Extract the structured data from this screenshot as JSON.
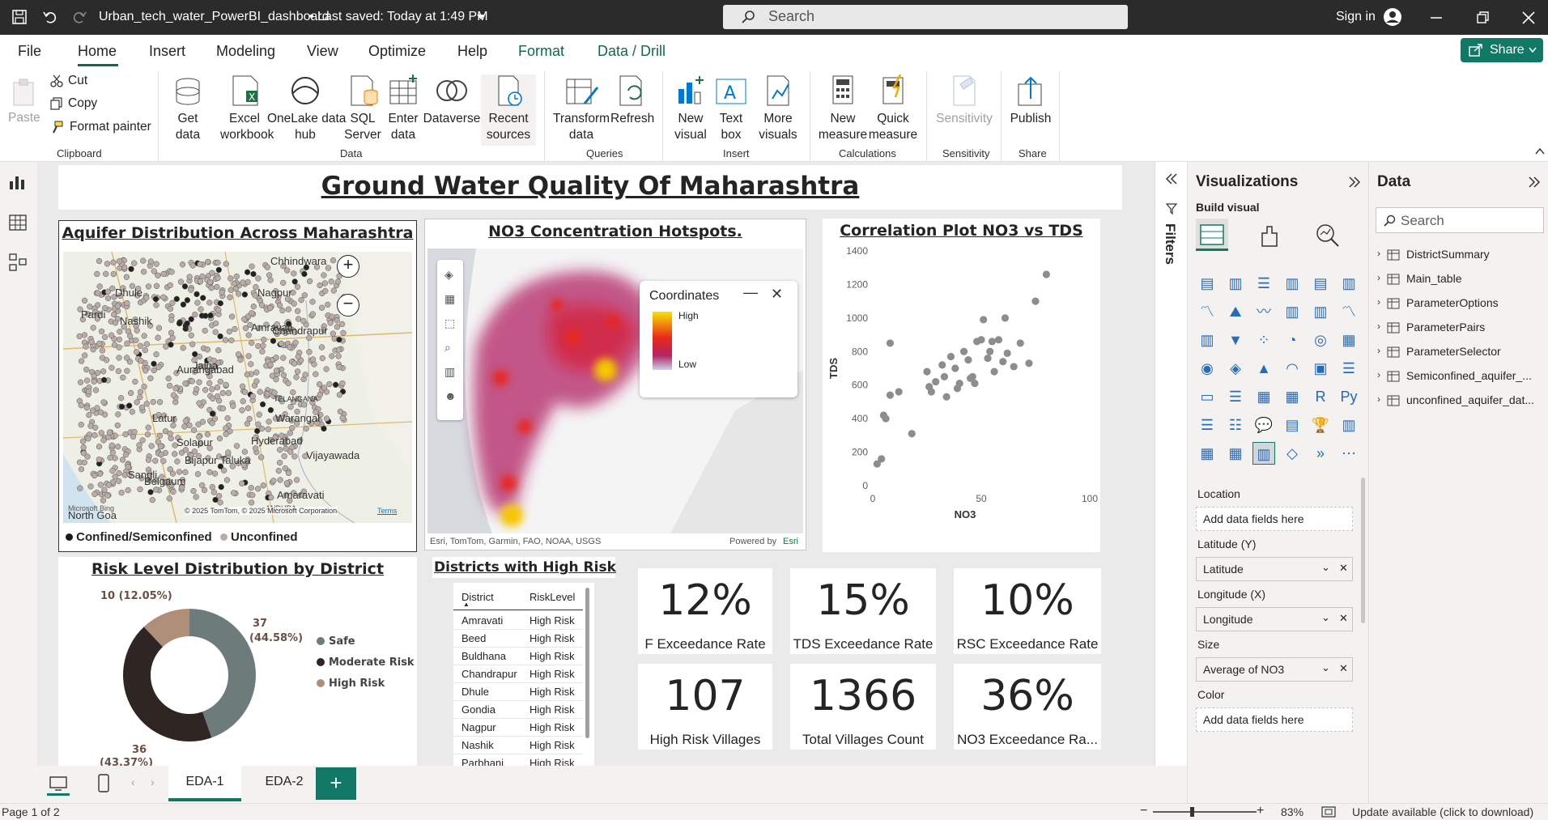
{
  "titlebar": {
    "filename": "Urban_tech_water_PowerBI_dashboard",
    "saved": "• Last saved: Today at 1:49 PM",
    "search_placeholder": "Search",
    "signin": "Sign in"
  },
  "menu": [
    "File",
    "Home",
    "Insert",
    "Modeling",
    "View",
    "Optimize",
    "Help",
    "Format",
    "Data / Drill"
  ],
  "share_label": "Share",
  "ribbon": {
    "paste": "Paste",
    "cut": "Cut",
    "copy": "Copy",
    "format_painter": "Format painter",
    "clipboard": "Clipboard",
    "get_data": [
      "Get",
      "data"
    ],
    "excel": [
      "Excel",
      "workbook"
    ],
    "onelake": [
      "OneLake data",
      "hub"
    ],
    "sql": [
      "SQL",
      "Server"
    ],
    "enter": [
      "Enter",
      "data"
    ],
    "dataverse": "Dataverse",
    "recent": [
      "Recent",
      "sources"
    ],
    "data_group": "Data",
    "transform": [
      "Transform",
      "data"
    ],
    "refresh": "Refresh",
    "queries": "Queries",
    "new_visual": [
      "New",
      "visual"
    ],
    "text_box": [
      "Text",
      "box"
    ],
    "more_visuals": [
      "More",
      "visuals"
    ],
    "insert": "Insert",
    "new_measure": [
      "New",
      "measure"
    ],
    "quick_measure": [
      "Quick",
      "measure"
    ],
    "calculations": "Calculations",
    "sensitivity": "Sensitivity",
    "sensitivity_group": "Sensitivity",
    "publish": "Publish",
    "share_group": "Share"
  },
  "report": {
    "title": "Ground Water Quality Of Maharashtra",
    "aquifer": {
      "title": "Aquifer Distribution Across Maharashtra",
      "legend": [
        "Confined/Semiconfined",
        "Unconfined"
      ],
      "places": [
        "Chhindwara",
        "Pardi",
        "Dhule",
        "Amravati",
        "Nagpur",
        "Chandrapur",
        "Nashik",
        "Aurangabad",
        "Jalna",
        "Latur",
        "Solapur",
        "Warangal",
        "Hyderabad",
        "Vijayawada",
        "Amaravati",
        "TELANGANA",
        "Bijapur Taluka",
        "Sangli",
        "Belgaum",
        "North Goa",
        "ANDHRA"
      ],
      "copyright": "© 2025 TomTom, © 2025 Microsoft Corporation",
      "terms": "Terms",
      "bing": "Microsoft Bing"
    },
    "hotspots": {
      "title": "NO3 Concentration Hotspots.",
      "legend_title": "Coordinates",
      "high": "High",
      "low": "Low",
      "attribution": "Esri, TomTom, Garmin, FAO, NOAA, USGS",
      "powered": "Powered by",
      "esri": "Esri"
    },
    "correlation": {
      "title": "Correlation Plot NO3 vs TDS"
    },
    "risk": {
      "title": "Risk Level Distribution by District",
      "labels": [
        "37",
        "(44.58%)",
        "36",
        "(43.37%)",
        "10 (12.05%)"
      ]
    },
    "districts": {
      "title": "Districts with High Risk",
      "headers": [
        "District",
        "RiskLevel"
      ],
      "rows": [
        [
          "Amravati",
          "High Risk"
        ],
        [
          "Beed",
          "High Risk"
        ],
        [
          "Buldhana",
          "High Risk"
        ],
        [
          "Chandrapur",
          "High Risk"
        ],
        [
          "Dhule",
          "High Risk"
        ],
        [
          "Gondia",
          "High Risk"
        ],
        [
          "Nagpur",
          "High Risk"
        ],
        [
          "Nashik",
          "High Risk"
        ],
        [
          "Parbhani",
          "High Risk"
        ]
      ]
    },
    "kpis": [
      {
        "value": "12%",
        "label": "F Exceedance Rate"
      },
      {
        "value": "15%",
        "label": "TDS Exceedance Rate"
      },
      {
        "value": "10%",
        "label": "RSC Exceedance Rate"
      },
      {
        "value": "107",
        "label": "High Risk Villages"
      },
      {
        "value": "1366",
        "label": "Total Villages Count"
      },
      {
        "value": "36%",
        "label": "NO3 Exceedance Ra..."
      }
    ]
  },
  "chart_data": [
    {
      "type": "scatter",
      "title": "Correlation Plot NO3 vs TDS",
      "xlabel": "NO3",
      "ylabel": "TDS",
      "xlim": [
        0,
        100
      ],
      "ylim": [
        0,
        1400
      ],
      "xticks": [
        0,
        50,
        100
      ],
      "yticks": [
        0,
        200,
        400,
        600,
        800,
        1000,
        1200,
        1400
      ],
      "points": [
        [
          8,
          850
        ],
        [
          5,
          420
        ],
        [
          6,
          400
        ],
        [
          8,
          540
        ],
        [
          12,
          560
        ],
        [
          4,
          160
        ],
        [
          2,
          130
        ],
        [
          18,
          310
        ],
        [
          25,
          680
        ],
        [
          26,
          590
        ],
        [
          27,
          560
        ],
        [
          29,
          620
        ],
        [
          32,
          720
        ],
        [
          33,
          650
        ],
        [
          34,
          530
        ],
        [
          36,
          770
        ],
        [
          38,
          700
        ],
        [
          40,
          610
        ],
        [
          42,
          800
        ],
        [
          44,
          750
        ],
        [
          46,
          650
        ],
        [
          47,
          610
        ],
        [
          48,
          860
        ],
        [
          50,
          870
        ],
        [
          51,
          990
        ],
        [
          53,
          760
        ],
        [
          54,
          800
        ],
        [
          55,
          860
        ],
        [
          56,
          680
        ],
        [
          58,
          870
        ],
        [
          60,
          740
        ],
        [
          61,
          1000
        ],
        [
          65,
          710
        ],
        [
          68,
          850
        ],
        [
          72,
          730
        ],
        [
          75,
          1100
        ],
        [
          80,
          1260
        ],
        [
          62,
          790
        ],
        [
          45,
          640
        ],
        [
          39,
          580
        ]
      ]
    },
    {
      "type": "pie",
      "title": "Risk Level Distribution by District",
      "categories": [
        "Safe",
        "Moderate Risk",
        "High Risk"
      ],
      "values": [
        37,
        36,
        10
      ],
      "percent": [
        44.58,
        43.37,
        12.05
      ],
      "colors": [
        "#6e7b7b",
        "#2f2523",
        "#b08f78"
      ]
    }
  ],
  "visualizations": {
    "title": "Visualizations",
    "build": "Build visual",
    "wells": [
      {
        "label": "Location",
        "value": "Add data fields here",
        "filled": false
      },
      {
        "label": "Latitude (Y)",
        "value": "Latitude",
        "filled": true
      },
      {
        "label": "Longitude (X)",
        "value": "Longitude",
        "filled": true
      },
      {
        "label": "Size",
        "value": "Average of NO3",
        "filled": true
      },
      {
        "label": "Color",
        "value": "Add data fields here",
        "filled": false
      }
    ]
  },
  "filters_label": "Filters",
  "data_pane": {
    "title": "Data",
    "search": "Search",
    "items": [
      "DistrictSummary",
      "Main_table",
      "ParameterOptions",
      "ParameterPairs",
      "ParameterSelector",
      "Semiconfined_aquifer_...",
      "unconfined_aquifer_dat..."
    ]
  },
  "pages": [
    "EDA-1",
    "EDA-2"
  ],
  "status": {
    "page": "Page 1 of 2",
    "zoom": "83%",
    "update": "Update available (click to download)"
  }
}
